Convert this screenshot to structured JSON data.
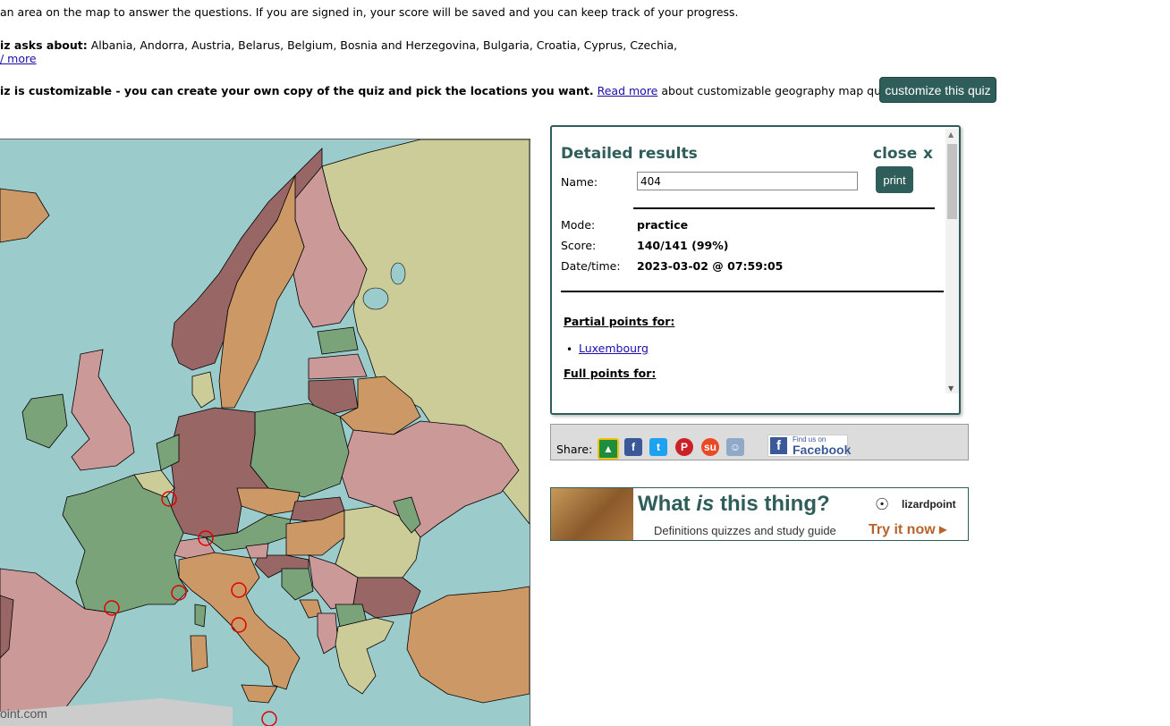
{
  "intro": {
    "instruction": " an area on the map to answer the questions. If you are signed in, your score will be saved and you can keep track of your progress.",
    "asks_label": "iz asks about:",
    "asks_list": " Albania, Andorra, Austria, Belarus, Belgium, Bosnia and Herzegovina, Bulgaria, Croatia, Cyprus, Czechia,",
    "see_more": "/ more",
    "custom_bold": "iz is customizable - you can create your own copy of the quiz and pick the locations you want.",
    "custom_link": "Read more",
    "custom_rest": " about customizable geography map quizzes.",
    "customize_button": "customize this quiz"
  },
  "map": {
    "credit": "oint.com",
    "colors": {
      "sea": "#9ccbcc",
      "pink": "#cc9999",
      "tan": "#cc9966",
      "green": "#7aa37a",
      "purple": "#996666",
      "khaki": "#cccc99"
    }
  },
  "results": {
    "title": "Detailed results",
    "close": "close",
    "close_x": "x",
    "name_label": "Name:",
    "name_value": "404",
    "print_label": "print",
    "mode_label": "Mode:",
    "mode_value": "practice",
    "score_label": "Score:",
    "score_value": "140/141 (99%)",
    "datetime_label": "Date/time:",
    "datetime_value": "2023-03-02 @ 07:59:05",
    "partial_heading": "Partial points for:",
    "partial_items": [
      "Luxembourg"
    ],
    "full_heading": "Full points for:"
  },
  "share": {
    "label": "Share:",
    "icons": [
      "google-classroom-icon",
      "facebook-icon",
      "twitter-icon",
      "pinterest-icon",
      "stumbleupon-icon",
      "reddit-icon"
    ],
    "fb_find": "Find us on",
    "fb_name": "Facebook"
  },
  "ad": {
    "headline_pre": "What ",
    "headline_em": "is",
    "headline_post": " this thing?",
    "subtitle": "Definitions quizzes and study guide",
    "brand": "lizardpoint",
    "cta": "Try it now ▸"
  }
}
